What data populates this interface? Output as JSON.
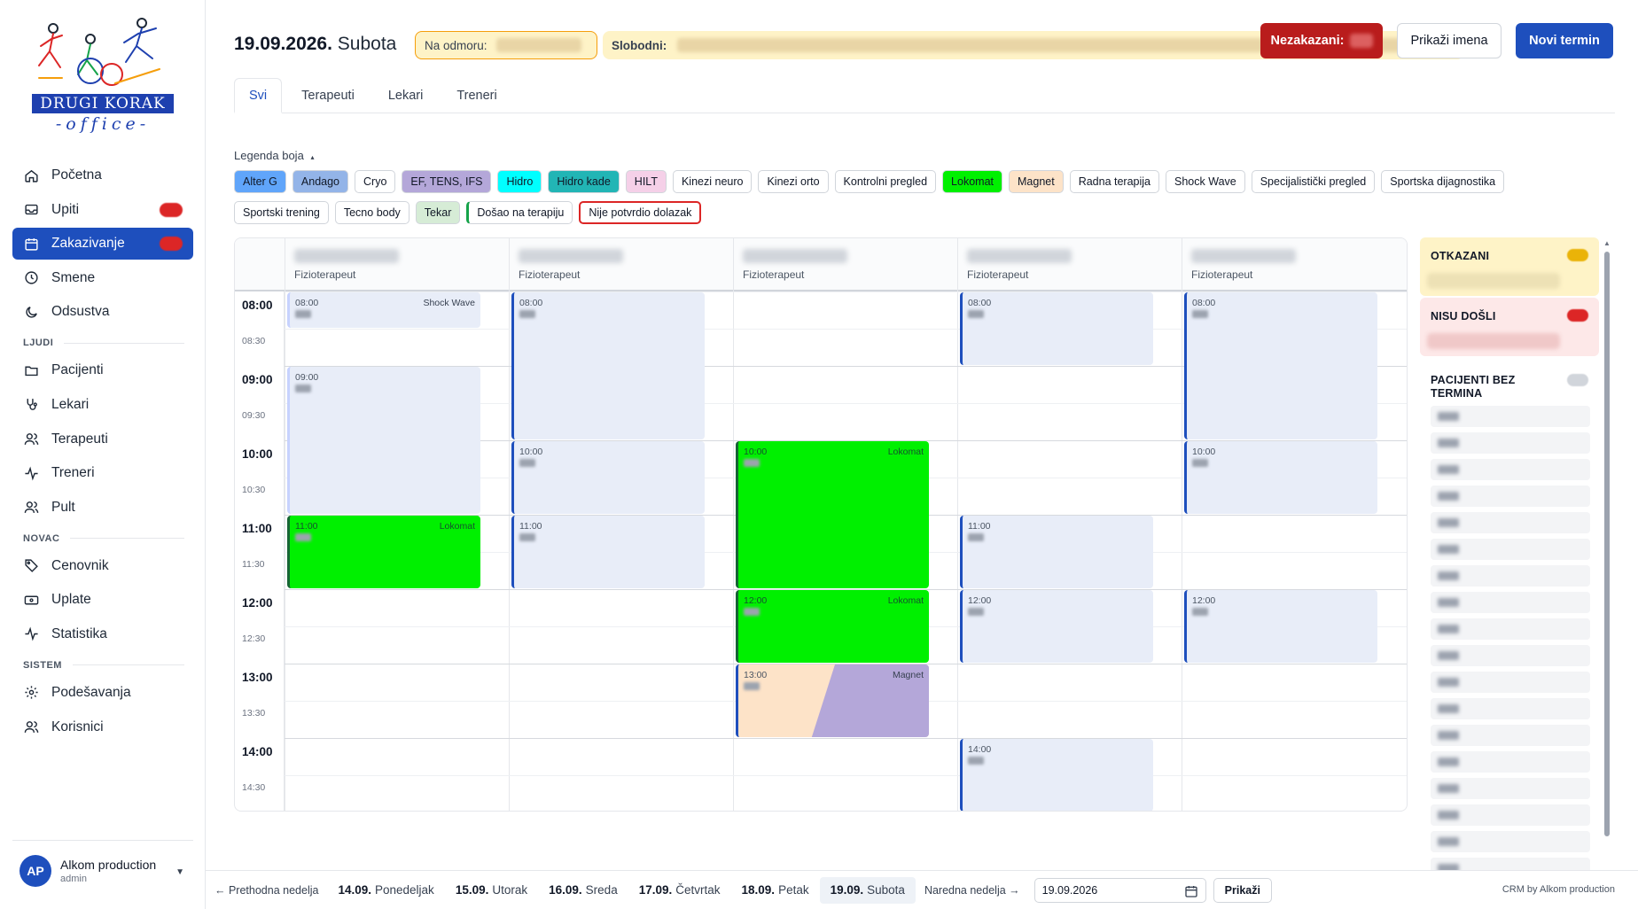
{
  "brand": {
    "name": "DRUGI KORAK",
    "sub": "-office-"
  },
  "colors": {
    "primary": "#1e4fbd",
    "danger": "#b91c1c",
    "warning_bg": "#fef3c7",
    "lokomat": "#00f000",
    "magnet": "#fde3c8"
  },
  "nav": {
    "items_main": [
      {
        "label": "Početna",
        "icon": "home-icon"
      },
      {
        "label": "Upiti",
        "icon": "inbox-icon"
      },
      {
        "label": "Zakazivanje",
        "icon": "calendar-icon"
      },
      {
        "label": "Smene",
        "icon": "clock-icon"
      },
      {
        "label": "Odsustva",
        "icon": "moon-icon"
      }
    ],
    "section_ljudi": "LJUDI",
    "items_ljudi": [
      {
        "label": "Pacijenti",
        "icon": "folder-icon"
      },
      {
        "label": "Lekari",
        "icon": "stethoscope-icon"
      },
      {
        "label": "Terapeuti",
        "icon": "users-icon"
      },
      {
        "label": "Treneri",
        "icon": "activity-icon"
      },
      {
        "label": "Pult",
        "icon": "users-icon"
      }
    ],
    "section_novac": "NOVAC",
    "items_novac": [
      {
        "label": "Cenovnik",
        "icon": "tag-icon"
      },
      {
        "label": "Uplate",
        "icon": "payment-icon"
      },
      {
        "label": "Statistika",
        "icon": "activity-icon"
      }
    ],
    "section_sistem": "SISTEM",
    "items_sistem": [
      {
        "label": "Podešavanja",
        "icon": "gear-icon"
      },
      {
        "label": "Korisnici",
        "icon": "users-icon"
      }
    ]
  },
  "user": {
    "initials": "AP",
    "name": "Alkom production",
    "role": "admin"
  },
  "header": {
    "date": "19.09.2026.",
    "day": "Subota",
    "vacation_label": "Na odmoru:",
    "free_label": "Slobodni:",
    "unscheduled_label": "Nezakazani:",
    "show_names": "Prikaži imena",
    "new_appointment": "Novi termin"
  },
  "tabs": [
    "Svi",
    "Terapeuti",
    "Lekari",
    "Treneri"
  ],
  "legend": {
    "title": "Legenda boja",
    "toggle": "▴",
    "chips": [
      {
        "label": "Alter G",
        "bg": "#60a5fa"
      },
      {
        "label": "Andago",
        "bg": "#93b4e8"
      },
      {
        "label": "Cryo",
        "bg": "#ffffff"
      },
      {
        "label": "EF, TENS, IFS",
        "bg": "#b4a7d9"
      },
      {
        "label": "Hidro",
        "bg": "#00ffff"
      },
      {
        "label": "Hidro kade",
        "bg": "#22b5b5"
      },
      {
        "label": "HILT",
        "bg": "#f5d0e8"
      },
      {
        "label": "Kinezi neuro",
        "bg": "#ffffff"
      },
      {
        "label": "Kinezi orto",
        "bg": "#ffffff"
      },
      {
        "label": "Kontrolni pregled",
        "bg": "#ffffff"
      },
      {
        "label": "Lokomat",
        "bg": "#00f000"
      },
      {
        "label": "Magnet",
        "bg": "#fde3c8"
      },
      {
        "label": "Radna terapija",
        "bg": "#ffffff"
      },
      {
        "label": "Shock Wave",
        "bg": "#ffffff"
      },
      {
        "label": "Specijalistički pregled",
        "bg": "#ffffff"
      },
      {
        "label": "Sportska dijagnostika",
        "bg": "#ffffff"
      },
      {
        "label": "Sportski trening",
        "bg": "#ffffff"
      },
      {
        "label": "Tecno body",
        "bg": "#ffffff"
      },
      {
        "label": "Tekar",
        "bg": "#d6ecd6"
      },
      {
        "label": "Došao na terapiju",
        "bg": "#ffffff",
        "kind": "dosao"
      },
      {
        "label": "Nije potvrdio dolazak",
        "bg": "#ffffff",
        "kind": "nije"
      }
    ]
  },
  "calendar": {
    "columns": [
      {
        "role": "Fizioterapeut"
      },
      {
        "role": "Fizioterapeut"
      },
      {
        "role": "Fizioterapeut"
      },
      {
        "role": "Fizioterapeut"
      },
      {
        "role": "Fizioterapeut"
      }
    ],
    "times": [
      {
        "hour": "08:00",
        "half": "08:30"
      },
      {
        "hour": "09:00",
        "half": "09:30"
      },
      {
        "hour": "10:00",
        "half": "10:30"
      },
      {
        "hour": "11:00",
        "half": "11:30"
      },
      {
        "hour": "12:00",
        "half": "12:30"
      },
      {
        "hour": "13:00",
        "half": "13:30"
      },
      {
        "hour": "14:00",
        "half": "14:30"
      }
    ],
    "appointments": [
      {
        "col": 0,
        "start": 0,
        "len": 1,
        "time": "08:00",
        "cat": "Shock Wave",
        "style": "light"
      },
      {
        "col": 0,
        "start": 2,
        "len": 4,
        "time": "09:00",
        "cat": "",
        "style": "light"
      },
      {
        "col": 0,
        "start": 6,
        "len": 2,
        "time": "11:00",
        "cat": "Lokomat",
        "style": "green"
      },
      {
        "col": 1,
        "start": 0,
        "len": 4,
        "time": "08:00",
        "cat": "",
        "style": "blue"
      },
      {
        "col": 1,
        "start": 4,
        "len": 2,
        "time": "10:00",
        "cat": "",
        "style": "blue"
      },
      {
        "col": 1,
        "start": 6,
        "len": 2,
        "time": "11:00",
        "cat": "",
        "style": "blue"
      },
      {
        "col": 2,
        "start": 4,
        "len": 4,
        "time": "10:00",
        "cat": "Lokomat",
        "style": "green"
      },
      {
        "col": 2,
        "start": 8,
        "len": 2,
        "time": "12:00",
        "cat": "Lokomat",
        "style": "green"
      },
      {
        "col": 2,
        "start": 10,
        "len": 2,
        "time": "13:00",
        "cat": "Magnet",
        "style": "magnet"
      },
      {
        "col": 3,
        "start": 0,
        "len": 2,
        "time": "08:00",
        "cat": "",
        "style": "blue"
      },
      {
        "col": 3,
        "start": 6,
        "len": 2,
        "time": "11:00",
        "cat": "",
        "style": "blue"
      },
      {
        "col": 3,
        "start": 8,
        "len": 2,
        "time": "12:00",
        "cat": "",
        "style": "blue"
      },
      {
        "col": 3,
        "start": 12,
        "len": 2,
        "time": "14:00",
        "cat": "",
        "style": "blue"
      },
      {
        "col": 4,
        "start": 0,
        "len": 4,
        "time": "08:00",
        "cat": "",
        "style": "blue"
      },
      {
        "col": 4,
        "start": 4,
        "len": 2,
        "time": "10:00",
        "cat": "",
        "style": "blue"
      },
      {
        "col": 4,
        "start": 8,
        "len": 2,
        "time": "12:00",
        "cat": "",
        "style": "blue"
      }
    ]
  },
  "rpanel": {
    "canceled": "OTKAZANI",
    "no_show": "NISU DOŠLI",
    "no_appt": "PACIJENTI BEZ TERMINA"
  },
  "footer": {
    "prev": "← Prethodna nedelja",
    "next": "Naredna nedelja →",
    "days": [
      {
        "d": "14.09.",
        "n": "Ponedeljak"
      },
      {
        "d": "15.09.",
        "n": "Utorak"
      },
      {
        "d": "16.09.",
        "n": "Sreda"
      },
      {
        "d": "17.09.",
        "n": "Četvrtak"
      },
      {
        "d": "18.09.",
        "n": "Petak"
      },
      {
        "d": "19.09.",
        "n": "Subota"
      }
    ],
    "date_value": "19.09.2026",
    "show": "Prikaži",
    "credit": "CRM by Alkom production"
  }
}
